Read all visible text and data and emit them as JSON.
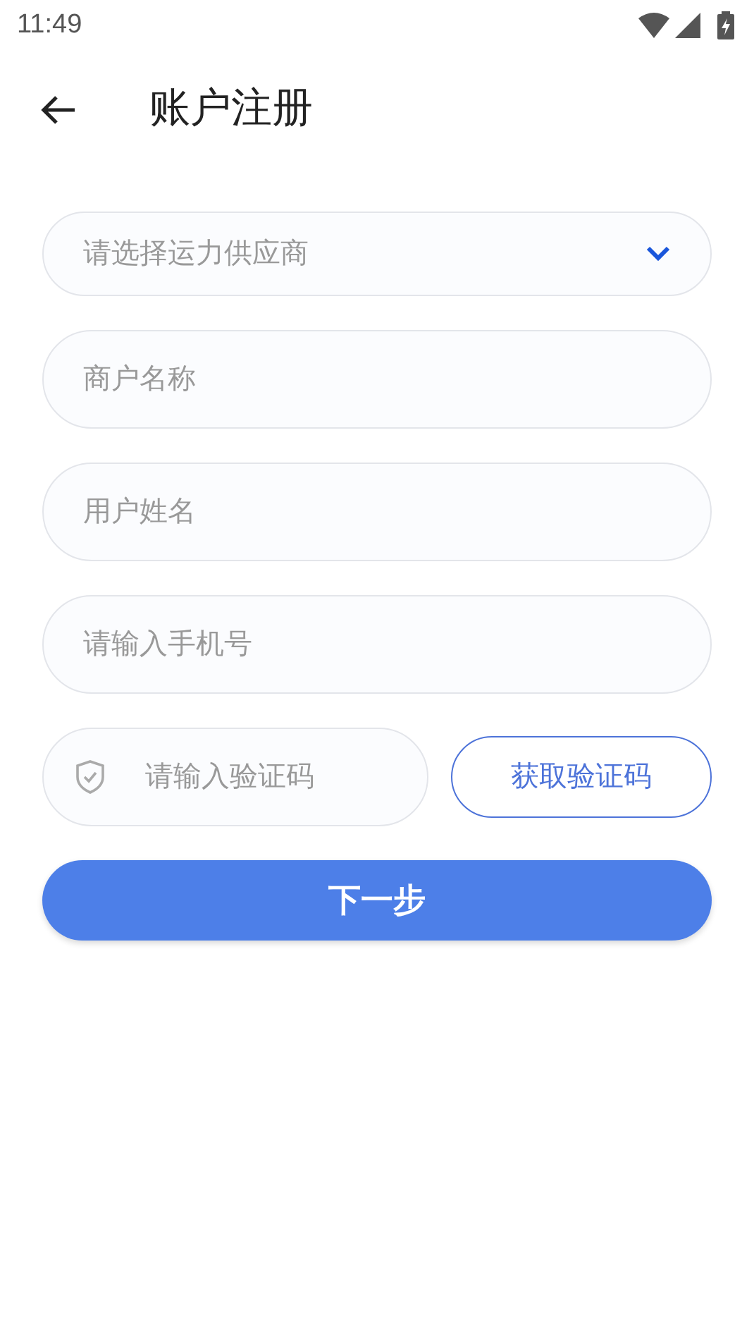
{
  "status_bar": {
    "time": "11:49"
  },
  "header": {
    "title": "账户注册"
  },
  "fields": [
    {
      "kind": "select",
      "placeholder": "请选择运力供应商"
    },
    {
      "kind": "text",
      "placeholder": "商户名称"
    },
    {
      "kind": "text",
      "placeholder": "用户姓名"
    },
    {
      "kind": "text",
      "placeholder": "请输入手机号"
    },
    {
      "kind": "code",
      "placeholder": "请输入验证码",
      "button": "获取验证码"
    }
  ],
  "submit_button": "下一步"
}
